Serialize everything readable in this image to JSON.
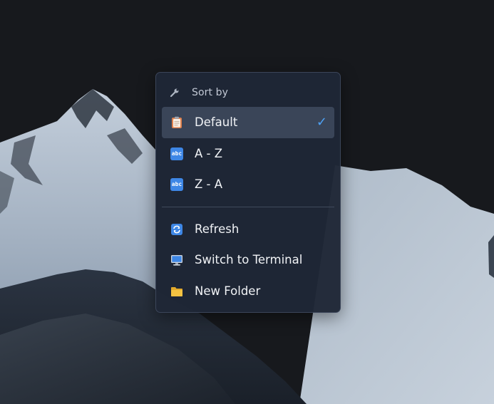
{
  "menu": {
    "header": {
      "label": "Sort by",
      "icon": "wrench-icon"
    },
    "items_top": [
      {
        "label": "Default",
        "icon": "clipboard-icon",
        "selected": true,
        "check": "✓"
      },
      {
        "label": "A - Z",
        "icon": "abc-icon",
        "icon_text": "abc"
      },
      {
        "label": "Z - A",
        "icon": "abc-icon",
        "icon_text": "abc"
      }
    ],
    "items_bottom": [
      {
        "label": "Refresh",
        "icon": "refresh-icon"
      },
      {
        "label": "Switch to Terminal",
        "icon": "terminal-icon"
      },
      {
        "label": "New Folder",
        "icon": "folder-icon"
      }
    ]
  },
  "colors": {
    "menu_bg": "#1f2736",
    "selected_bg": "#3a4558",
    "accent": "#4ea2f5",
    "abc_icon": "#3e87e6",
    "folder": "#f5c342"
  }
}
